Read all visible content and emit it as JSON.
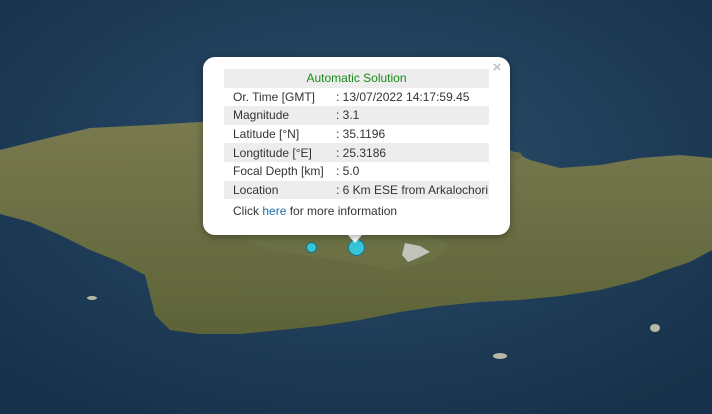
{
  "popup": {
    "title": "Automatic Solution",
    "close_symbol": "×",
    "rows": [
      {
        "label": "Or. Time [GMT]",
        "value": ": 13/07/2022 14:17:59.45"
      },
      {
        "label": "Magnitude",
        "value": ": 3.1"
      },
      {
        "label": "Latitude [°N]",
        "value": ": 35.1196"
      },
      {
        "label": "Longtitude [°E]",
        "value": ": 25.3186"
      },
      {
        "label": "Focal Depth [km]",
        "value": ": 5.0"
      },
      {
        "label": "Location",
        "value": ": 6 Km ESE from Arkalochori"
      }
    ],
    "more": {
      "prefix": "Click ",
      "link": "here",
      "suffix": " for more information"
    }
  },
  "markers": [
    {
      "name": "main-event",
      "color": "#37c4d8"
    },
    {
      "name": "secondary-event",
      "color": "#37c4d8"
    }
  ],
  "colors": {
    "sea": "#1d3a57",
    "land": "#6b6e45",
    "title_green": "#1a8a1a",
    "link_blue": "#1a6fb0"
  }
}
